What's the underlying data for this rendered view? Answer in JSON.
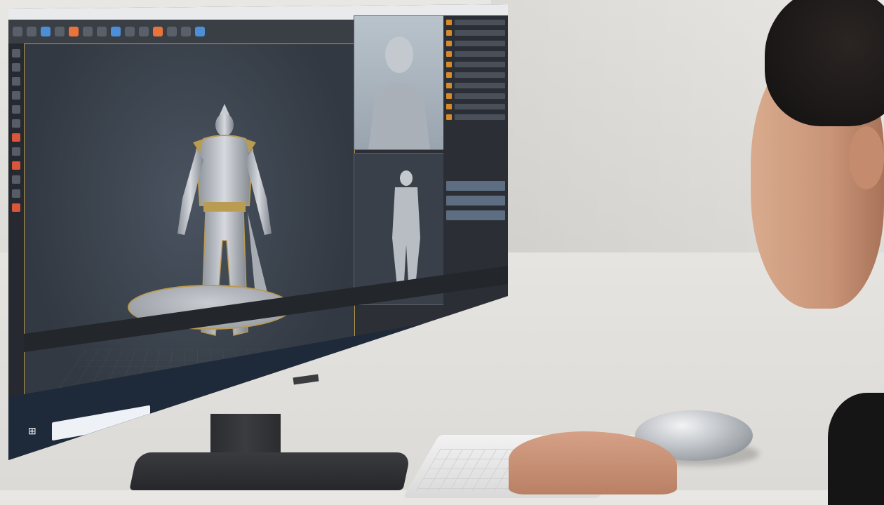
{
  "scene": {
    "description_hidden": "",
    "software": {
      "menu_items": [],
      "viewport_axis_label": ""
    }
  },
  "colors": {
    "accent": "#e8743b",
    "selection_frame": "#b79a4a",
    "ui_dark": "#2c3036"
  },
  "icons": {
    "start": "windows-start-icon",
    "search": "search-icon"
  }
}
